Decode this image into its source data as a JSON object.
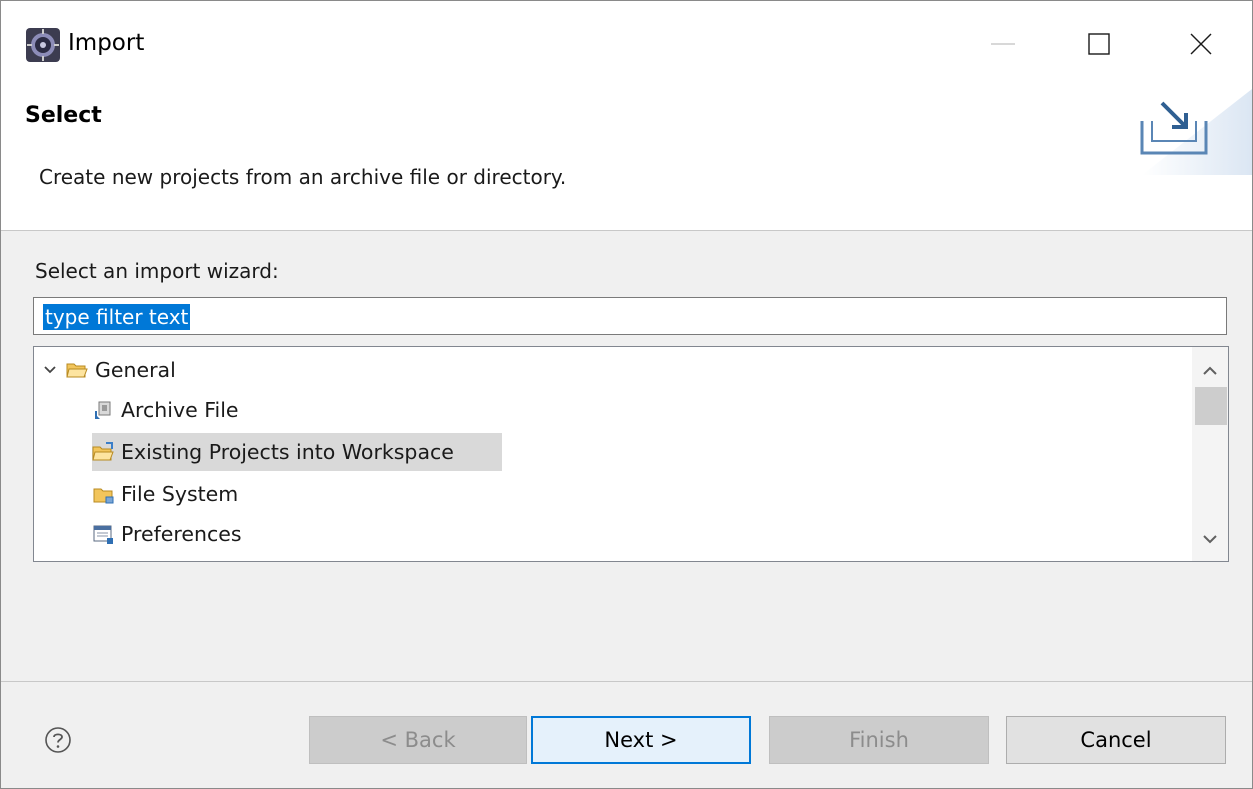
{
  "window": {
    "title": "Import",
    "controls": {
      "minimize": "minimize",
      "maximize": "maximize",
      "close": "close"
    }
  },
  "header": {
    "title": "Select",
    "description": "Create new projects from an archive file or directory."
  },
  "wizard": {
    "label": "Select an import wizard:",
    "filter_value": "type filter text",
    "tree": {
      "group": {
        "label": "General",
        "expanded": true
      },
      "items": [
        {
          "label": "Archive File",
          "icon": "archive-file-icon",
          "selected": false
        },
        {
          "label": "Existing Projects into Workspace",
          "icon": "existing-projects-icon",
          "selected": true
        },
        {
          "label": "File System",
          "icon": "file-system-folder-icon",
          "selected": false
        },
        {
          "label": "Preferences",
          "icon": "preferences-icon",
          "selected": false
        }
      ]
    }
  },
  "buttons": {
    "back": "< Back",
    "next": "Next >",
    "finish": "Finish",
    "cancel": "Cancel"
  },
  "colors": {
    "selection_highlight": "#0078d7",
    "tree_selected_row": "#d9d9d9",
    "dialog_background": "#f0f0f0"
  }
}
